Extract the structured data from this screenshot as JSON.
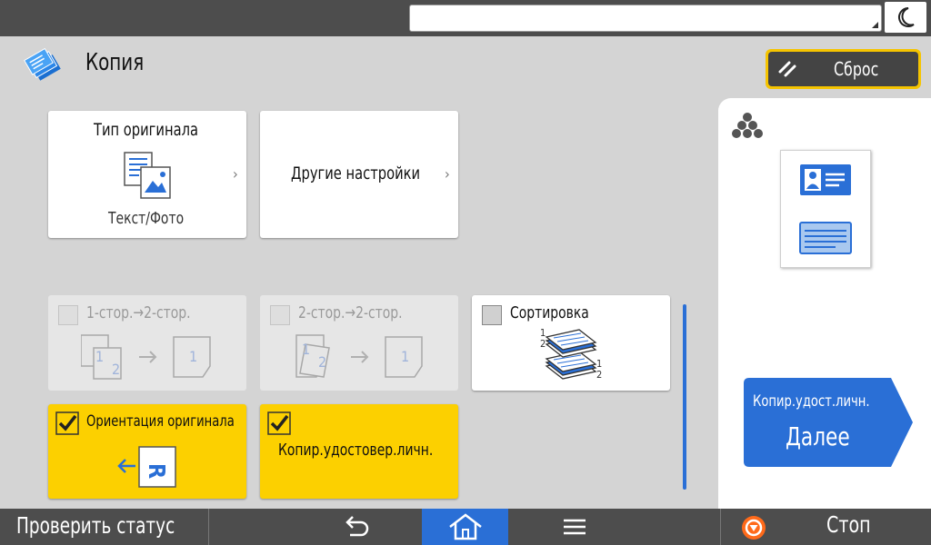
{
  "app": {
    "title": "Копия"
  },
  "toolbar": {
    "reset_label": "Сброс"
  },
  "tiles": {
    "original_type": {
      "title": "Тип оригинала",
      "value": "Текст/Фото"
    },
    "other_settings": {
      "title": "Другие настройки"
    },
    "duplex_1_2": {
      "label": "1-стор.→2-стор.",
      "checked": false,
      "enabled": false
    },
    "duplex_2_2": {
      "label": "2-стор.→2-стор.",
      "checked": false,
      "enabled": false
    },
    "sort": {
      "label": "Сортировка",
      "checked": false,
      "enabled": true
    },
    "orientation": {
      "label": "Ориентация оригинала",
      "checked": true,
      "icon_letter": "R"
    },
    "id_copy": {
      "label": "Копир.удостовер.личн.",
      "checked": true
    }
  },
  "glyphs": {
    "page_1": "1",
    "page_2": "2"
  },
  "preview": {
    "next_title": "Копир.удост.личн.",
    "next_label": "Далее"
  },
  "bottom": {
    "status_label": "Проверить статус",
    "stop_label": "Стоп"
  },
  "colors": {
    "accent_yellow": "#fcd000",
    "accent_blue": "#2a6fd6",
    "bar_gray": "#4d4d4d",
    "stop_orange": "#ff6a1a"
  }
}
